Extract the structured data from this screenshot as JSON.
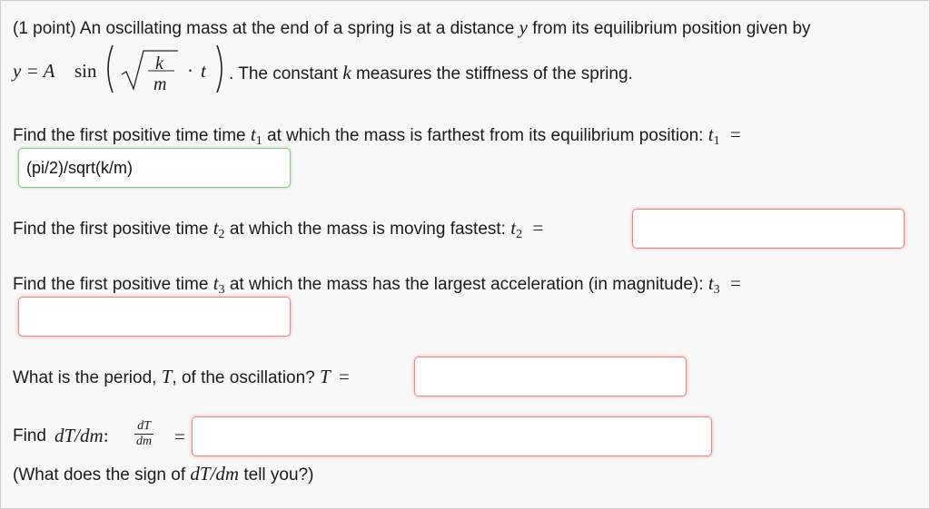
{
  "problem": {
    "intro": "(1 point) An oscillating mass at the end of a spring is at a distance",
    "intro_var": "y",
    "intro_end": "from its equilibrium position given by",
    "eq_lhs": "y = A",
    "eq_sin": "sin",
    "eq_num": "k",
    "eq_den": "m",
    "eq_t": "t",
    "after_eq": ". The constant",
    "k_var": "k",
    "after_k": "measures the stiffness of the spring."
  },
  "q1": {
    "text": "Find the first positive time time",
    "var": "t",
    "sub": "1",
    "text2": "at which the mass is farthest from its equilibrium position:",
    "eq": "=",
    "answer": "(pi/2)/sqrt(k/m)"
  },
  "q2": {
    "text": "Find the first positive time",
    "var": "t",
    "sub": "2",
    "text2": "at which the mass is moving fastest:",
    "eq": "=",
    "answer": ""
  },
  "q3": {
    "text": "Find the first positive time",
    "var": "t",
    "sub": "3",
    "text2": "at which the mass has the largest acceleration (in magnitude):",
    "eq": "=",
    "answer": ""
  },
  "q4": {
    "text": "What is the period,",
    "var": "T",
    "text2": ", of the oscillation?",
    "eq": "=",
    "answer": ""
  },
  "q5": {
    "text": "Find",
    "var": "dT/dm",
    "colon": ":",
    "num": "dT",
    "den": "dm",
    "eq": "=",
    "answer": "",
    "note_pre": "(What does the sign of",
    "note_var": "dT/dm",
    "note_post": "tell you?)"
  }
}
